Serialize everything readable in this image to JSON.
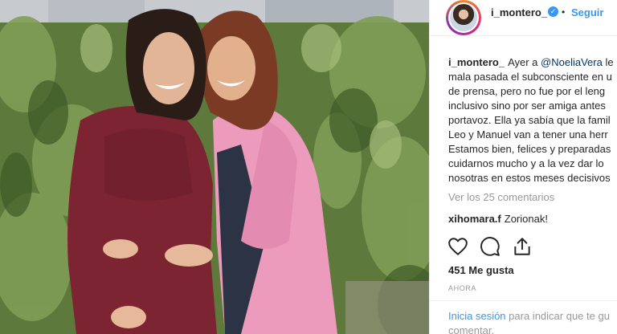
{
  "post": {
    "photo_icon": "photo-two-women"
  },
  "header": {
    "username": "i_montero_",
    "verified_icon": "verified-badge-icon",
    "separator": "•",
    "follow_label": "Seguir"
  },
  "caption": {
    "username": "i_montero_",
    "lines": [
      "Ayer a",
      "mala pasada el subconsciente en u",
      "de prensa, pero no fue por el leng",
      "inclusivo sino por ser amiga antes",
      "portavoz. Ella ya sabía que la famil",
      "Leo y Manuel van a tener una herr",
      "Estamos bien, felices y preparadas",
      "cuidarnos mucho y a la vez dar lo",
      "nosotras en estos meses decisivos"
    ],
    "mention": "@NoeliaVera",
    "after_mention": "le"
  },
  "comments": {
    "view_all_label": "Ver los 25 comentarios",
    "items": [
      {
        "user": "xihomara.f",
        "text": "Zorionak!"
      }
    ]
  },
  "actions": {
    "like_icon": "heart-icon",
    "comment_icon": "comment-icon",
    "share_icon": "share-icon"
  },
  "likes": {
    "label": "451 Me gusta"
  },
  "time": {
    "label": "AHORA"
  },
  "login": {
    "link_label": "Inicia sesión",
    "text": "para indicar que te gu",
    "text2": "comentar."
  },
  "colors": {
    "link": "#3897f0",
    "mention": "#003569",
    "muted": "#999999",
    "text": "#262626"
  }
}
